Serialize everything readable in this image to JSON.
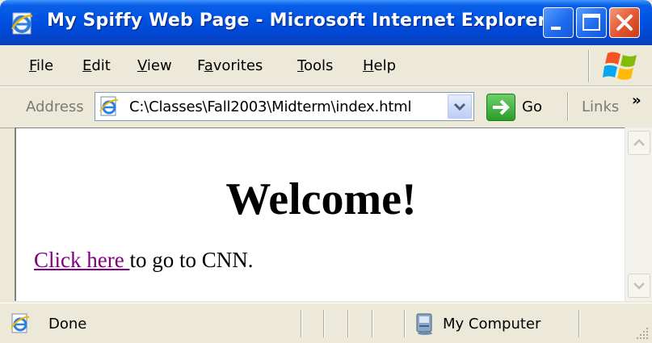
{
  "window": {
    "title": "My Spiffy Web Page - Microsoft Internet Explorer",
    "accent_color": "#0054e3",
    "close_color": "#e2552f"
  },
  "menu": {
    "items": [
      {
        "label": "File",
        "accesskey_index": 0
      },
      {
        "label": "Edit",
        "accesskey_index": 0
      },
      {
        "label": "View",
        "accesskey_index": 0
      },
      {
        "label": "Favorites",
        "accesskey_index": 1
      },
      {
        "label": "Tools",
        "accesskey_index": 0
      },
      {
        "label": "Help",
        "accesskey_index": 0
      }
    ]
  },
  "address_bar": {
    "label": "Address",
    "url": "C:\\Classes\\Fall2003\\Midterm\\index.html",
    "go_label": "Go",
    "links_label": "Links",
    "chevron": "»"
  },
  "page": {
    "heading": "Welcome!",
    "link_text": "Click here ",
    "after_link_text": "to go to CNN.",
    "link_color": "#800080"
  },
  "status_bar": {
    "status_text": "Done",
    "zone_text": "My Computer"
  },
  "icons": {
    "title": "ie-icon",
    "minimize": "minimize-icon",
    "maximize": "maximize-icon",
    "close": "close-icon",
    "windows_logo": "windows-logo-icon",
    "page": "page-icon",
    "dropdown": "chevron-down-icon",
    "go": "go-arrow-icon",
    "status": "ie-page-icon",
    "zone": "computer-icon"
  }
}
